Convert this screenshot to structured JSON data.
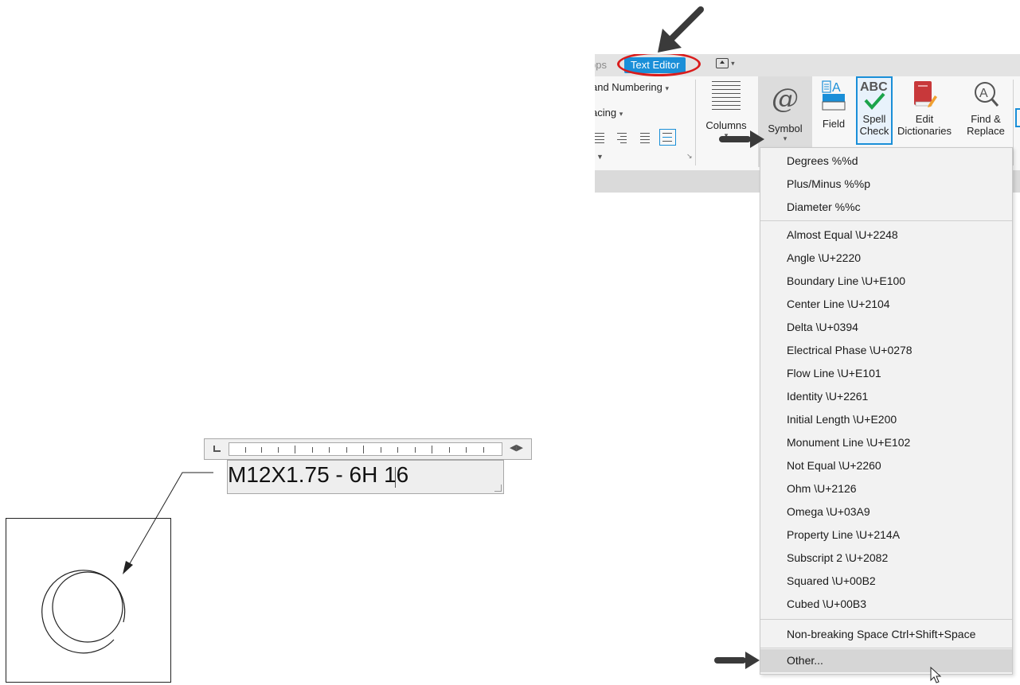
{
  "ribbon": {
    "tabs": {
      "apps": "pps",
      "text_editor": "Text Editor"
    },
    "left_group": {
      "bullets": "and Numbering",
      "spacing": "acing"
    },
    "buttons": {
      "columns": "Columns",
      "symbol": "Symbol",
      "field": "Field",
      "spell_line1": "Spell",
      "spell_line2": "Check",
      "edit_dict_line1": "Edit",
      "edit_dict_line2": "Dictionaries",
      "find_line1": "Find &",
      "find_line2": "Replace"
    },
    "accent_color": "#1a8fd8",
    "highlight_ring_color": "#d91c1c"
  },
  "symbol_menu": {
    "group1": [
      "Degrees  %%d",
      "Plus/Minus  %%p",
      "Diameter  %%c"
    ],
    "group2": [
      "Almost Equal  \\U+2248",
      "Angle  \\U+2220",
      "Boundary Line  \\U+E100",
      "Center Line  \\U+2104",
      "Delta  \\U+0394",
      "Electrical Phase  \\U+0278",
      "Flow Line  \\U+E101",
      "Identity  \\U+2261",
      "Initial Length  \\U+E200",
      "Monument Line  \\U+E102",
      "Not Equal  \\U+2260",
      "Ohm  \\U+2126",
      "Omega  \\U+03A9",
      "Property Line  \\U+214A",
      "Subscript 2  \\U+2082",
      "Squared  \\U+00B2",
      "Cubed  \\U+00B3"
    ],
    "group3": [
      "Non-breaking Space Ctrl+Shift+Space"
    ],
    "other": "Other..."
  },
  "mtext": {
    "content": "M12X1.75 - 6H 16"
  }
}
